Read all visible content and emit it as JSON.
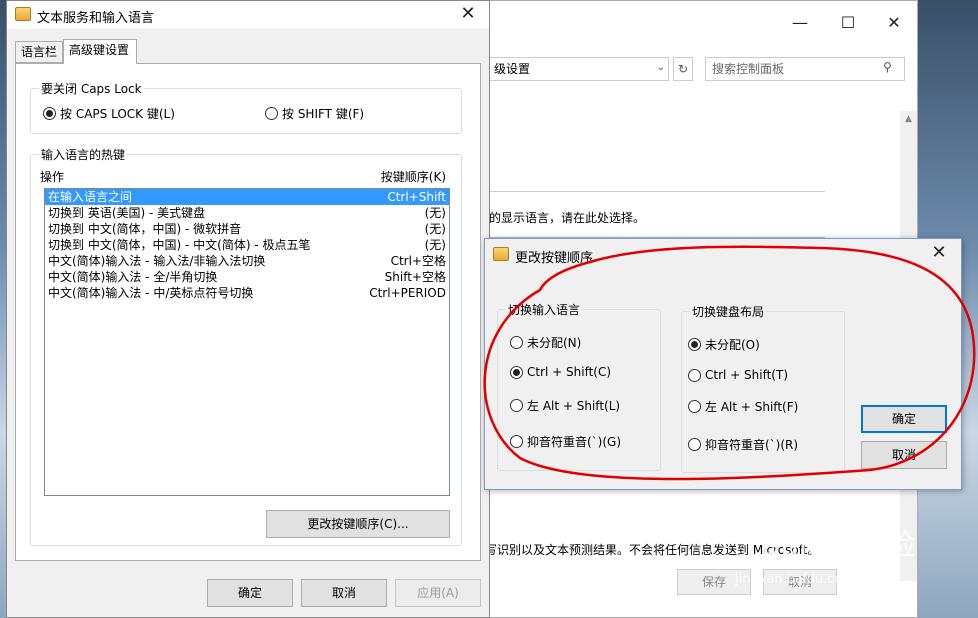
{
  "background_window": {
    "address_text": "级设置",
    "search_placeholder": "搜索控制面板",
    "display_language_text": "的显示语言，请在此处选择。",
    "privacy_text": "写识别以及文本预测结果。不会将任何信息发送到 Microsoft。",
    "save_label": "保存",
    "cancel_label": "取消",
    "minimize_glyph": "—",
    "maximize_glyph": "☐",
    "close_glyph": "✕",
    "refresh_glyph": "↻",
    "dropdown_glyph": "⌄",
    "search_glyph": "⚲",
    "scroll_up_glyph": "▲"
  },
  "main_dialog": {
    "title": "文本服务和输入语言",
    "close_glyph": "✕",
    "tabs": [
      {
        "label": "语言栏",
        "active": false
      },
      {
        "label": "高级键设置",
        "active": true
      }
    ],
    "caps_group": {
      "legend": "要关闭 Caps Lock",
      "options": [
        {
          "label": "按 CAPS LOCK 键(L)",
          "checked": true
        },
        {
          "label": "按 SHIFT 键(F)",
          "checked": false
        }
      ]
    },
    "hotkeys_group": {
      "legend": "输入语言的热键",
      "col_action": "操作",
      "col_keys": "按键顺序(K)",
      "rows": [
        {
          "action": "在输入语言之间",
          "keys": "Ctrl+Shift",
          "selected": true
        },
        {
          "action": "切换到 英语(美国) - 美式键盘",
          "keys": "(无)",
          "selected": false
        },
        {
          "action": "切换到 中文(简体，中国) - 微软拼音",
          "keys": "(无)",
          "selected": false
        },
        {
          "action": "切换到 中文(简体，中国) - 中文(简体) - 极点五笔",
          "keys": "(无)",
          "selected": false
        },
        {
          "action": "中文(简体)输入法 - 输入法/非输入法切换",
          "keys": "Ctrl+空格",
          "selected": false
        },
        {
          "action": "中文(简体)输入法 - 全/半角切换",
          "keys": "Shift+空格",
          "selected": false
        },
        {
          "action": "中文(简体)输入法 - 中/英标点符号切换",
          "keys": "Ctrl+PERIOD",
          "selected": false
        }
      ],
      "change_button": "更改按键顺序(C)..."
    },
    "ok_label": "确定",
    "cancel_label": "取消",
    "apply_label": "应用(A)"
  },
  "change_dialog": {
    "title": "更改按键顺序",
    "close_glyph": "✕",
    "input_lang_group": {
      "legend": "切换输入语言",
      "options": [
        {
          "label": "未分配(N)",
          "checked": false
        },
        {
          "label": "Ctrl + Shift(C)",
          "checked": true
        },
        {
          "label": "左 Alt + Shift(L)",
          "checked": false
        },
        {
          "label": "抑音符重音(`)(G)",
          "checked": false
        }
      ]
    },
    "keyboard_layout_group": {
      "legend": "切换键盘布局",
      "options": [
        {
          "label": "未分配(O)",
          "checked": true
        },
        {
          "label": "Ctrl + Shift(T)",
          "checked": false
        },
        {
          "label": "左 Alt + Shift(F)",
          "checked": false
        },
        {
          "label": "抑音符重音(`)(R)",
          "checked": false
        }
      ]
    },
    "ok_label": "确定",
    "cancel_label": "取消"
  },
  "watermark": {
    "brand": "Baidu 经验",
    "url": "jingyan.baidu.com"
  },
  "colors": {
    "selection": "#3399ff",
    "annotation": "#e00000",
    "default_button_border": "#0078d7"
  }
}
